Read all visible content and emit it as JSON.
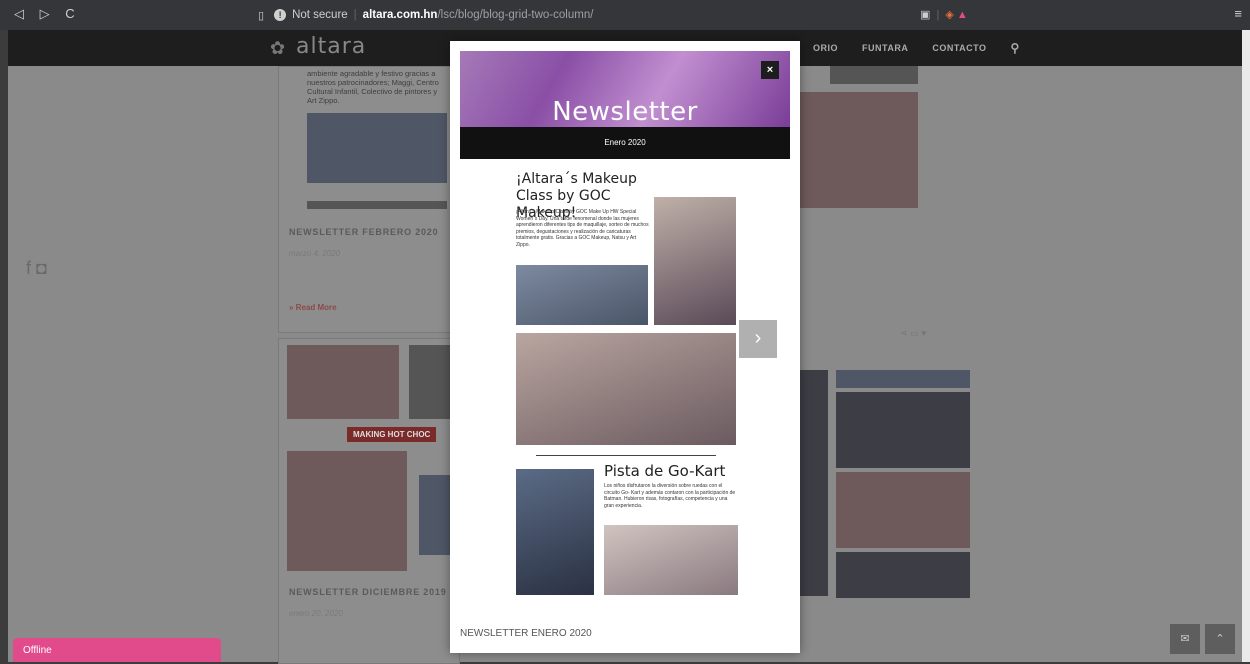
{
  "browser": {
    "back": "◁",
    "forward": "▷",
    "reload": "C",
    "security": "Not secure",
    "host": "altara.com.hn",
    "path": "/lsc/blog/blog-grid-two-column/"
  },
  "site": {
    "logo_text": "altara",
    "nav": [
      "ORIO",
      "FUNTARA",
      "CONTACTO"
    ]
  },
  "background": {
    "social_icons": [
      "facebook-icon",
      "instagram-icon"
    ],
    "top_card_text": "ambiente agradable y festivo gracias a nuestros patrocinadores; Maggi, Centro Cultural Infantil, Colectivo de pintores y Art Zippo.",
    "card1": {
      "title": "NEWSLETTER FEBRERO 2020",
      "date": "marzo 4, 2020",
      "read_more": "» Read More"
    },
    "banner": "MAKING HOT CHOC",
    "card2": {
      "title": "NEWSLETTER DICIEMBRE 2019",
      "date": "enero 20, 2020"
    }
  },
  "modal": {
    "close": "×",
    "newsletter_title": "Newsletter",
    "month": "Enero 2020",
    "article1": {
      "title": "¡Altara´s Makeup Class by GOC Makeup!",
      "text": "¡Altara´s Makeup Class by GOC Make Up HW Special Women´s Day. Una tarde fenomenal donde las mujeres aprendieron diferentes tips de maquillaje, sorteo de muchos premios, degustaciones y realización de caricaturas totalmente gratis. Gracias a GOC Makeup, Natsu y Art Zippo."
    },
    "article2": {
      "title": "Pista de Go-Kart",
      "text": "Los niños disfrutaron la diversión sobre ruedas con el circuito Go- Kart y además contaron con la participación de Batman. Hubieron risas, fotografías, competencia y una gran experiencia."
    },
    "caption": "NEWSLETTER ENERO 2020",
    "next": "›"
  },
  "chat": {
    "status": "Offline"
  }
}
